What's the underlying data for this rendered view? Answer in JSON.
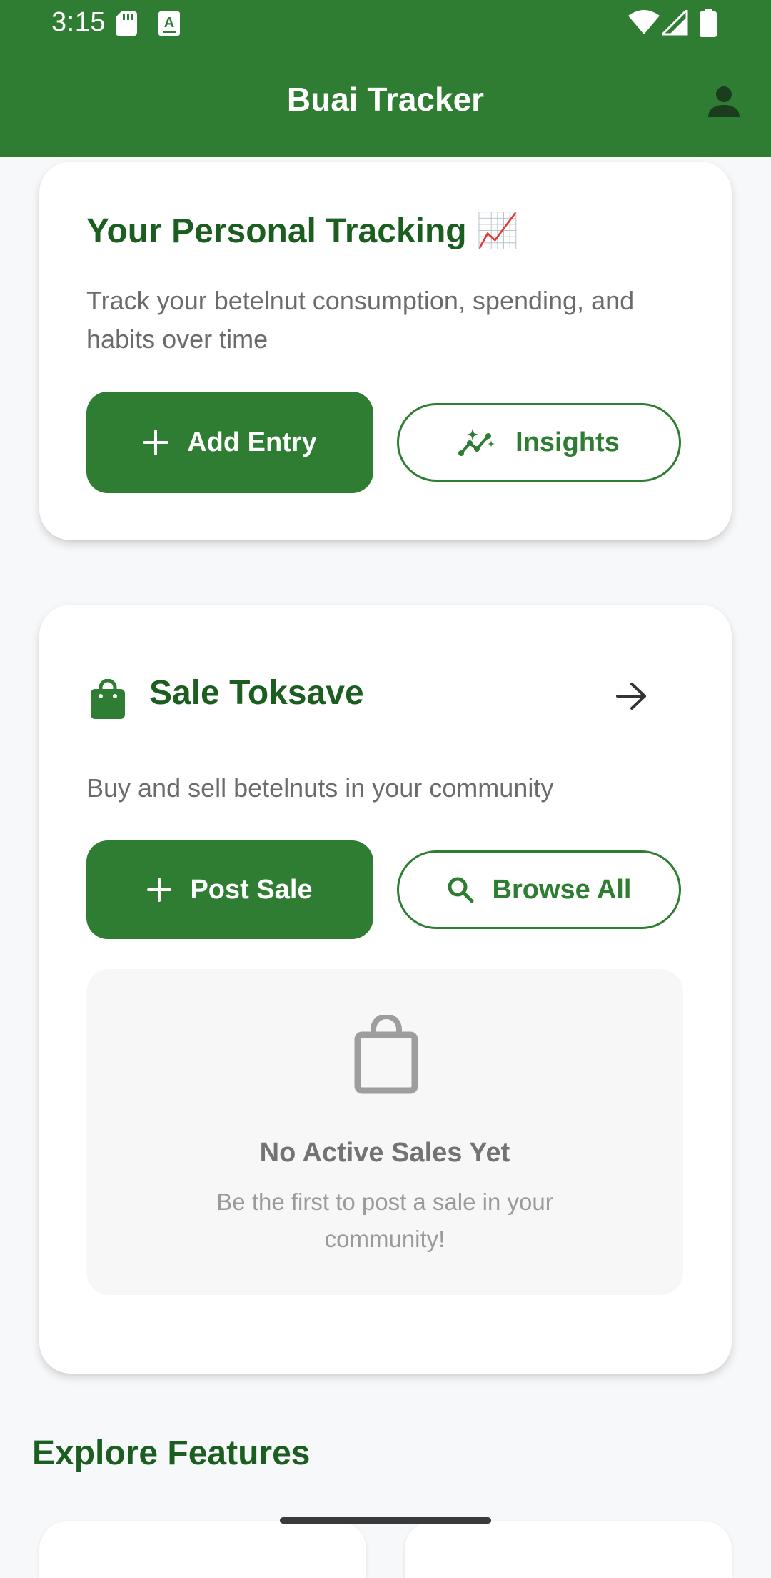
{
  "status_bar": {
    "time": "3:15"
  },
  "app_bar": {
    "title": "Buai Tracker"
  },
  "tracking_card": {
    "title": "Your Personal Tracking 📈",
    "description": "Track your betelnut consumption, spending, and habits over time",
    "add_entry_label": "Add Entry",
    "insights_label": "Insights"
  },
  "sale_card": {
    "title": "Sale Toksave",
    "description": "Buy and sell betelnuts in your community",
    "post_sale_label": "Post Sale",
    "browse_all_label": "Browse All",
    "empty_title": "No Active Sales Yet",
    "empty_subtitle": "Be the first to post a sale in your community!"
  },
  "explore": {
    "title": "Explore Features"
  },
  "colors": {
    "primary": "#2e7d32",
    "primary_dark": "#1b5e20",
    "background": "#f7f8fa"
  },
  "icons": {
    "status": [
      "sd-card-icon",
      "keyboard-a-icon",
      "wifi-icon",
      "signal-icon",
      "battery-icon"
    ],
    "app_bar": "account-icon",
    "tracking": [
      "plus-icon",
      "insights-icon"
    ],
    "sale": [
      "shopping-bag-icon",
      "arrow-right-icon",
      "plus-icon",
      "search-icon",
      "empty-bag-icon"
    ]
  }
}
